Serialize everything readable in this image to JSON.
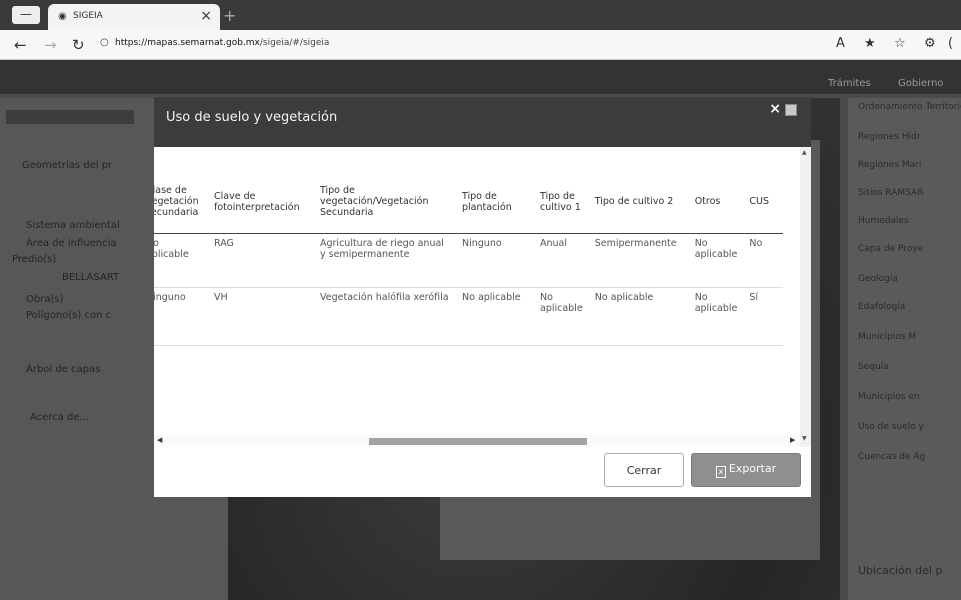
{
  "browser": {
    "tab_title": "SIGEIA",
    "url_host": "https://mapas.semarnat.gob.mx",
    "url_path": "/sigeia/#/sigeia",
    "tab_close": "×",
    "new_tab": "+",
    "window_button": "—"
  },
  "page": {
    "topnav": [
      "Trámites",
      "Gobierno"
    ],
    "left_panel": {
      "header": "Geometrías del pr",
      "items": [
        "Sistema ambiental",
        "Área de influencia",
        "Predio(s)",
        "BELLASART",
        "Obra(s)",
        "Polígono(s) con c"
      ],
      "arbol": "Árbol de capas",
      "acerca": "Acerca de..."
    },
    "right_panel": {
      "items": [
        "Ordenamiento Territorio",
        "Regiones Hidr",
        "Regiones Mari",
        "Sitios RAMSAR",
        "Humedales",
        "Capa de Proye",
        "Geología",
        "Edafología",
        "Municipios M",
        "Sequía",
        "Municipios en",
        "Uso de suelo y",
        "Cuencas de Ag"
      ],
      "ubicacion": "Ubicación del p"
    }
  },
  "modal": {
    "title": "Uso de suelo y vegetación",
    "close_icon": "×",
    "columns": [
      "Clase de vegetación secundaria",
      "Clave de fotointerpretación",
      "Tipo de vegetación/Vegetación Secundaria",
      "Tipo de plantación",
      "Tipo de cultivo 1",
      "Tipo de cultivo 2",
      "Otros",
      "CUS"
    ],
    "rows": [
      [
        "No aplicable",
        "RAG",
        "Agricultura de riego anual y semipermanente",
        "Ninguno",
        "Anual",
        "Semipermanente",
        "No aplicable",
        "No"
      ],
      [
        "Ninguno",
        "VH",
        "Vegetación halófila xerófila",
        "No aplicable",
        "No aplicable",
        "No aplicable",
        "No aplicable",
        "Sí"
      ]
    ],
    "buttons": {
      "cerrar": "Cerrar",
      "exportar": "Exportar"
    }
  }
}
